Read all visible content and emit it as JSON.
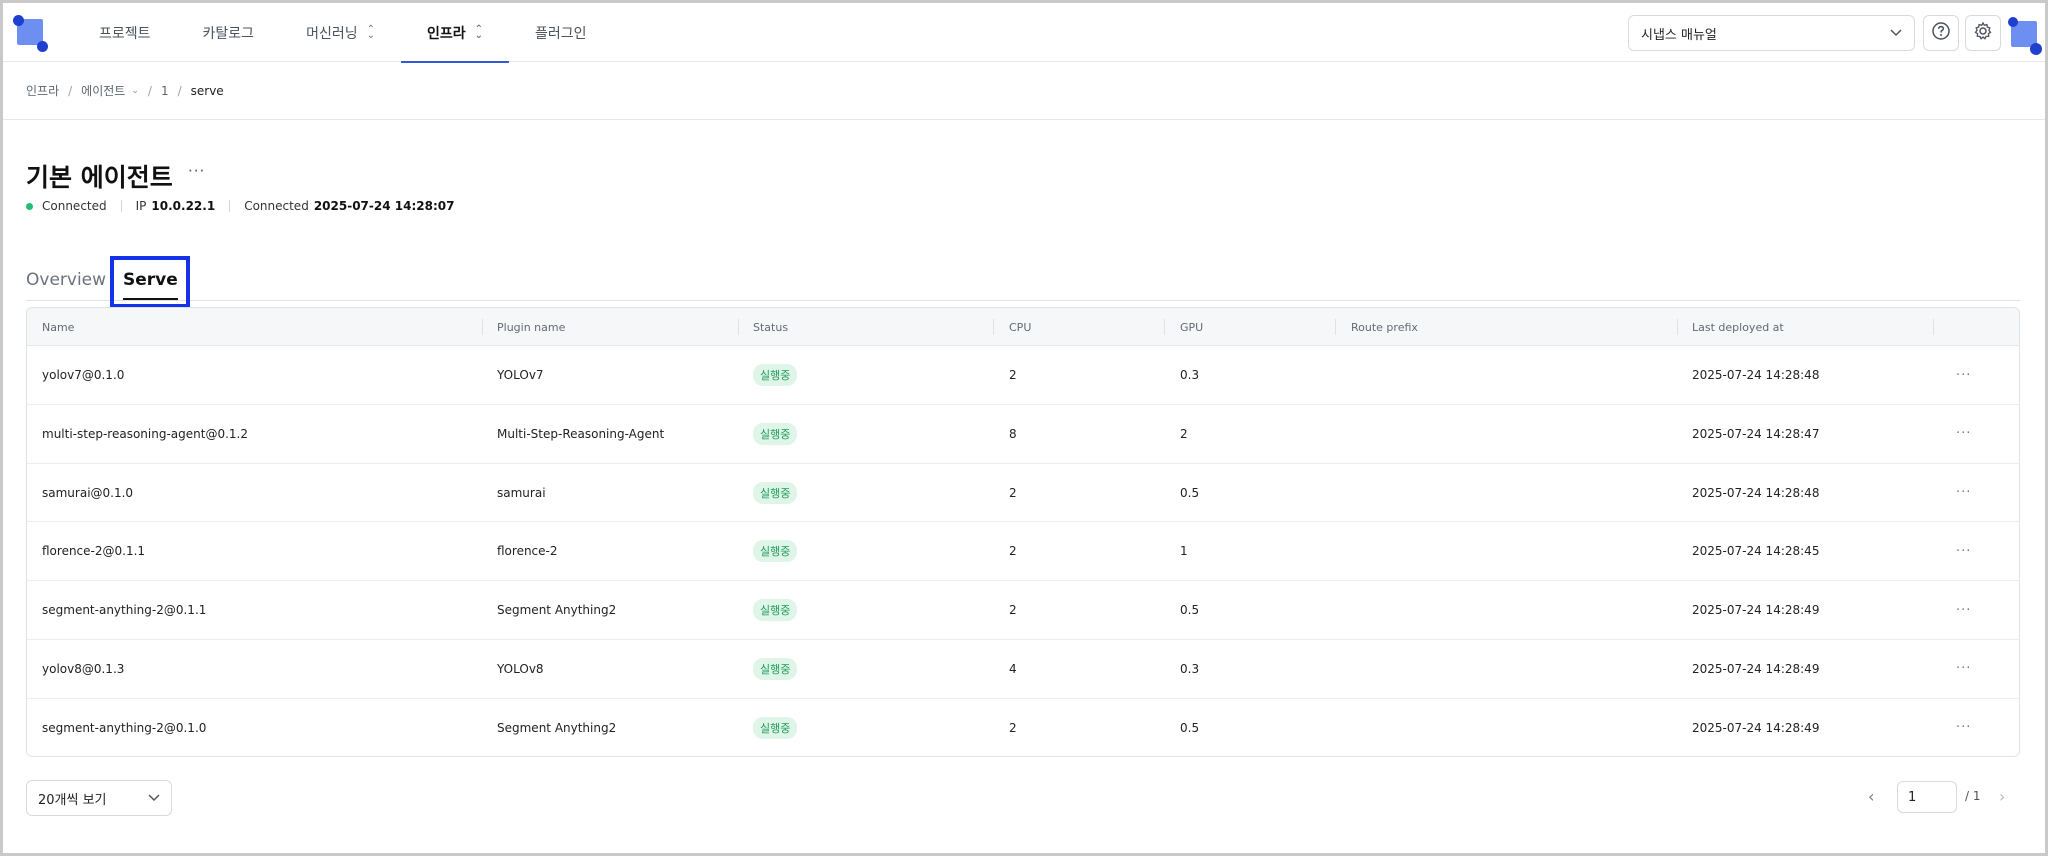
{
  "nav": {
    "items": [
      {
        "label": "프로젝트",
        "chevron": false
      },
      {
        "label": "카탈로그",
        "chevron": false
      },
      {
        "label": "머신러닝",
        "chevron": true
      },
      {
        "label": "인프라",
        "chevron": true,
        "active": true
      },
      {
        "label": "플러그인",
        "chevron": false
      }
    ],
    "project_select": "시냅스 매뉴얼",
    "help_icon": "help-circle-icon",
    "settings_icon": "gear-icon"
  },
  "breadcrumb": {
    "items": [
      "인프라",
      "에이전트",
      "1",
      "serve"
    ]
  },
  "agent": {
    "title": "기본 에이전트",
    "more": "···",
    "status": "Connected",
    "ip_label": "IP",
    "ip": "10.0.22.1",
    "connected_label": "Connected",
    "connected_at": "2025-07-24 14:28:07",
    "status_color": "#1fbe73"
  },
  "tabs": [
    "Overview",
    "Serve"
  ],
  "table": {
    "columns": [
      "Name",
      "Plugin name",
      "Status",
      "CPU",
      "GPU",
      "Route prefix",
      "Last deployed at"
    ],
    "rows": [
      {
        "name": "yolov7@0.1.0",
        "plugin": "YOLOv7",
        "status": "실행중",
        "cpu": "2",
        "gpu": "0.3",
        "route": "",
        "deployed": "2025-07-24 14:28:48"
      },
      {
        "name": "multi-step-reasoning-agent@0.1.2",
        "plugin": "Multi-Step-Reasoning-Agent",
        "status": "실행중",
        "cpu": "8",
        "gpu": "2",
        "route": "",
        "deployed": "2025-07-24 14:28:47"
      },
      {
        "name": "samurai@0.1.0",
        "plugin": "samurai",
        "status": "실행중",
        "cpu": "2",
        "gpu": "0.5",
        "route": "",
        "deployed": "2025-07-24 14:28:48"
      },
      {
        "name": "florence-2@0.1.1",
        "plugin": "florence-2",
        "status": "실행중",
        "cpu": "2",
        "gpu": "1",
        "route": "",
        "deployed": "2025-07-24 14:28:45"
      },
      {
        "name": "segment-anything-2@0.1.1",
        "plugin": "Segment Anything2",
        "status": "실행중",
        "cpu": "2",
        "gpu": "0.5",
        "route": "",
        "deployed": "2025-07-24 14:28:49"
      },
      {
        "name": "yolov8@0.1.3",
        "plugin": "YOLOv8",
        "status": "실행중",
        "cpu": "4",
        "gpu": "0.3",
        "route": "",
        "deployed": "2025-07-24 14:28:49"
      },
      {
        "name": "segment-anything-2@0.1.0",
        "plugin": "Segment Anything2",
        "status": "실행중",
        "cpu": "2",
        "gpu": "0.5",
        "route": "",
        "deployed": "2025-07-24 14:28:49"
      }
    ],
    "row_more": "···"
  },
  "footer": {
    "page_size": "20개씩 보기",
    "page": "1",
    "total": "/ 1"
  },
  "colors": {
    "accent": "#3457d5",
    "highlight": "#1433e8",
    "badge_bg": "#dff5e8",
    "badge_text": "#1d9a5a"
  }
}
